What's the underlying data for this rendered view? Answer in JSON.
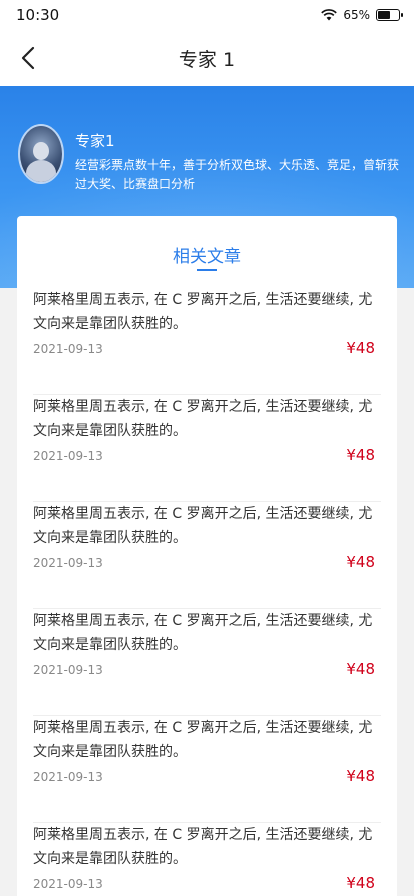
{
  "status_bar": {
    "time": "10:30",
    "battery": "65%",
    "battery_level": 0.65
  },
  "header": {
    "title": "专家 1"
  },
  "expert": {
    "name": "专家1",
    "description": "经营彩票点数十年，善于分析双色球、大乐透、竞足，曾斩获过大奖、比赛盘口分析"
  },
  "section": {
    "title": "相关文章"
  },
  "articles": [
    {
      "title": "阿莱格里周五表示, 在 C 罗离开之后, 生活还要继续, 尤文向来是靠团队获胜的。",
      "date": "2021-09-13",
      "price": "¥48"
    },
    {
      "title": "阿莱格里周五表示, 在 C 罗离开之后, 生活还要继续, 尤文向来是靠团队获胜的。",
      "date": "2021-09-13",
      "price": "¥48"
    },
    {
      "title": "阿莱格里周五表示, 在 C 罗离开之后, 生活还要继续, 尤文向来是靠团队获胜的。",
      "date": "2021-09-13",
      "price": "¥48"
    },
    {
      "title": "阿莱格里周五表示, 在 C 罗离开之后, 生活还要继续, 尤文向来是靠团队获胜的。",
      "date": "2021-09-13",
      "price": "¥48"
    },
    {
      "title": "阿莱格里周五表示, 在 C 罗离开之后, 生活还要继续, 尤文向来是靠团队获胜的。",
      "date": "2021-09-13",
      "price": "¥48"
    },
    {
      "title": "阿莱格里周五表示, 在 C 罗离开之后, 生活还要继续, 尤文向来是靠团队获胜的。",
      "date": "2021-09-13",
      "price": "¥48"
    }
  ]
}
